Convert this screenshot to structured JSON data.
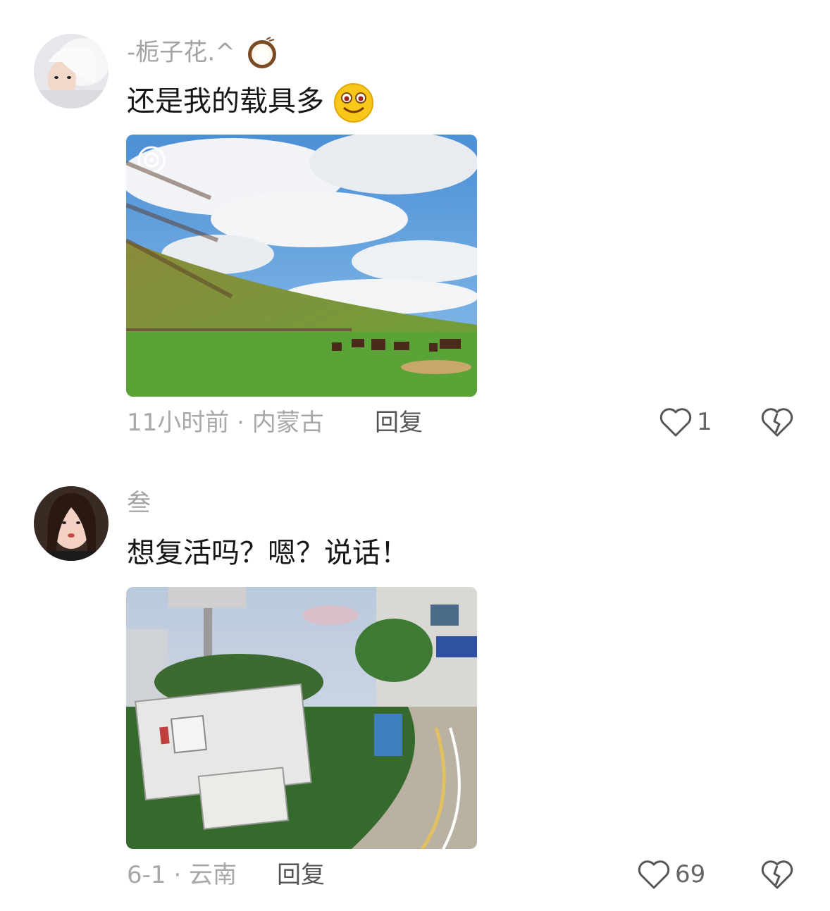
{
  "comments": [
    {
      "username": "-栀子花.^",
      "username_emoji": "coconut-emoji",
      "text": "还是我的载具多",
      "text_emoji": "smiling-face-emoji",
      "image": "grassland-horses-photo",
      "time": "11小时前",
      "location": "内蒙古",
      "reply_label": "回复",
      "likes": "1"
    },
    {
      "username": "叁",
      "text": "想复活吗？嗯？说话！",
      "image": "cell-tower-equipment-photo",
      "time": "6-1",
      "location": "云南",
      "reply_label": "回复",
      "likes": "69"
    }
  ],
  "colors": {
    "username": "#a3a3a3",
    "text": "#161616",
    "meta": "#a8a8a8",
    "reply": "#555555"
  }
}
